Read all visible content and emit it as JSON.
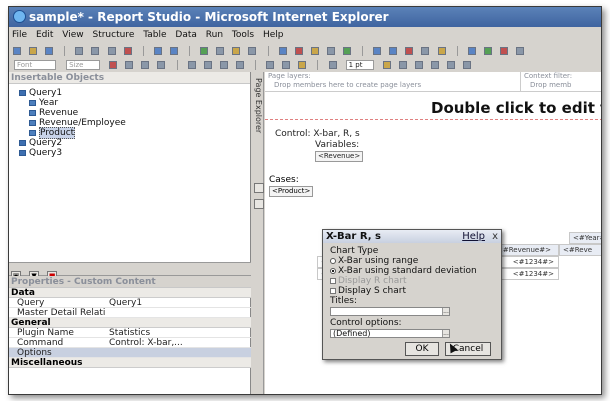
{
  "window": {
    "title": "sample* - Report Studio - Microsoft Internet Explorer"
  },
  "menubar": [
    "File",
    "Edit",
    "View",
    "Structure",
    "Table",
    "Data",
    "Run",
    "Tools",
    "Help"
  ],
  "format_toolbar": {
    "font": "Font",
    "size": "Size",
    "line": "1 pt"
  },
  "insertable": {
    "header": "Insertable Objects",
    "tree": {
      "query1": "Query1",
      "year": "Year",
      "revenue": "Revenue",
      "rev_emp": "Revenue/Employee",
      "product": "Product",
      "query2": "Query2",
      "query3": "Query3"
    }
  },
  "properties": {
    "header": "Properties - Custom Content",
    "group_data": "Data",
    "query_k": "Query",
    "query_v": "Query1",
    "mdr_k": "Master Detail Relationships",
    "mdr_v": "",
    "group_general": "General",
    "plugin_k": "Plugin Name",
    "plugin_v": "Statistics",
    "command_k": "Command",
    "command_v": "Control: X-bar,...",
    "options_k": "Options",
    "options_v": "",
    "group_misc": "Miscellaneous"
  },
  "vtabs": {
    "explorer": "Page Explorer"
  },
  "canvas": {
    "page_layers": "Page layers:",
    "page_layers_hint": "Drop members here to create page layers",
    "context_filter": "Context filter:",
    "context_hint": "Drop memb",
    "double_click": "Double click to edit t",
    "control": "Control: X-bar, R, s",
    "variables": "Variables:",
    "revenue_box": "<Revenue>",
    "cases": "Cases:",
    "product_box": "<Product>",
    "year_cell": "<#Year#",
    "revenue_cell": "<#Revenue#>",
    "revenue_cell_short": "<#Reve",
    "num1": "<#1234#>",
    "num2": "<#1234#>",
    "row1": "<#",
    "row2": "<#"
  },
  "dialog": {
    "title": "X-Bar R, s",
    "help": "Help",
    "close": "x",
    "chart_type": "Chart Type",
    "opt_range": "X-Bar using range",
    "opt_std": "X-Bar using standard deviation",
    "opt_r": "Display R chart",
    "opt_s": "Display S chart",
    "titles": "Titles:",
    "control_options": "Control options:",
    "defined": "(Defined)",
    "ok": "OK",
    "cancel": "Cancel"
  }
}
